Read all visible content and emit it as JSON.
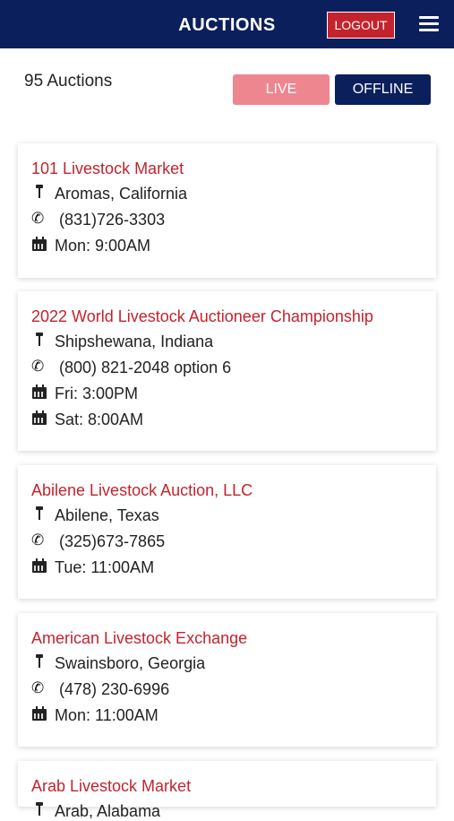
{
  "header": {
    "title": "AUCTIONS",
    "logout_label": "LOGOUT"
  },
  "summary": {
    "count_label": "95 Auctions"
  },
  "tabs": {
    "live": "LIVE",
    "offline": "OFFLINE"
  },
  "colors": {
    "navy": "#0b1f5c",
    "red": "#c4232d",
    "live_pink": "#ee8690"
  },
  "auctions": [
    {
      "name": "101 Livestock Market",
      "location": "Aromas, California",
      "phone": "(831)726-3303",
      "schedule": [
        "Mon: 9:00AM"
      ]
    },
    {
      "name": "2022 World Livestock Auctioneer Championship",
      "location": "Shipshewana, Indiana",
      "phone": "(800) 821-2048 option 6",
      "schedule": [
        "Fri: 3:00PM",
        "Sat: 8:00AM"
      ]
    },
    {
      "name": "Abilene Livestock Auction, LLC",
      "location": "Abilene, Texas",
      "phone": "(325)673-7865",
      "schedule": [
        "Tue: 11:00AM"
      ]
    },
    {
      "name": "American Livestock Exchange",
      "location": "Swainsboro, Georgia",
      "phone": "(478) 230-6996",
      "schedule": [
        "Mon: 11:00AM"
      ]
    },
    {
      "name": "Arab Livestock Market",
      "location": "Arab, Alabama",
      "phone": "",
      "schedule": []
    }
  ]
}
